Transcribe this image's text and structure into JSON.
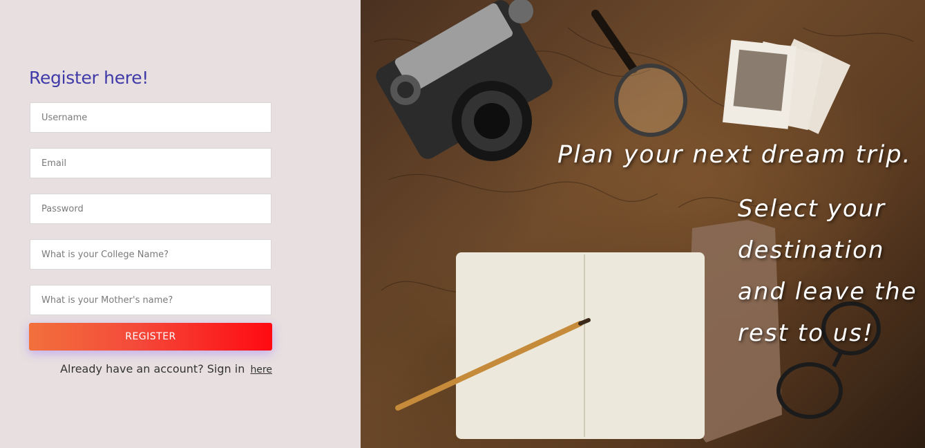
{
  "form": {
    "title": "Register here!",
    "fields": [
      {
        "name": "username",
        "placeholder": "Username",
        "value": ""
      },
      {
        "name": "email",
        "placeholder": "Email",
        "value": ""
      },
      {
        "name": "password",
        "placeholder": "Password",
        "value": ""
      },
      {
        "name": "college",
        "placeholder": "What is your College Name?",
        "value": ""
      },
      {
        "name": "mother",
        "placeholder": "What is your Mother's name?",
        "value": ""
      }
    ],
    "register_label": "REGISTER",
    "signin_prompt": "Already have an account? Sign in",
    "signin_link": "here"
  },
  "hero": {
    "headline": "Plan your next dream trip.",
    "tagline": "Select your destination and leave the rest to us!"
  },
  "colors": {
    "left_bg": "#e8dfe0",
    "title": "#3f3aa8",
    "button_start": "#f2703c",
    "button_end": "#ff0a12"
  }
}
